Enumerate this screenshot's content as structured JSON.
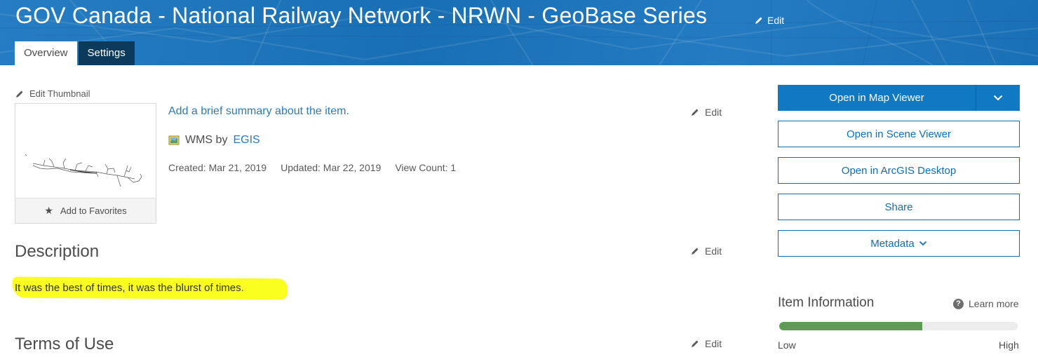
{
  "header": {
    "title": "GOV Canada - National Railway Network - NRWN - GeoBase Series",
    "edit_label": "Edit",
    "tabs": [
      {
        "label": "Overview",
        "active": true
      },
      {
        "label": "Settings",
        "active": false
      }
    ]
  },
  "thumbnail": {
    "edit_label": "Edit Thumbnail",
    "favorite_label": "Add to Favorites"
  },
  "summary": {
    "link_text": "Add a brief summary about the item.",
    "edit_label": "Edit",
    "item_type": "WMS by",
    "owner": "EGIS",
    "created": "Created: Mar 21, 2019",
    "updated": "Updated: Mar 22, 2019",
    "view_count": "View Count: 1"
  },
  "description": {
    "title": "Description",
    "edit_label": "Edit",
    "text": "It was the best of times, it was the blurst of times."
  },
  "terms": {
    "title": "Terms of Use",
    "edit_label": "Edit"
  },
  "actions": {
    "open_map_viewer": "Open in Map Viewer",
    "open_scene_viewer": "Open in Scene Viewer",
    "open_arcgis_desktop": "Open in ArcGIS Desktop",
    "share": "Share",
    "metadata": "Metadata"
  },
  "item_information": {
    "title": "Item Information",
    "learn_more": "Learn more",
    "low_label": "Low",
    "high_label": "High",
    "score_fraction": 0.6
  },
  "colors": {
    "banner": "#1b76bf",
    "primary": "#0f79c4",
    "link": "#2d7bb6",
    "highlight": "#fbff1f",
    "meter_fill": "#5e9b54"
  }
}
